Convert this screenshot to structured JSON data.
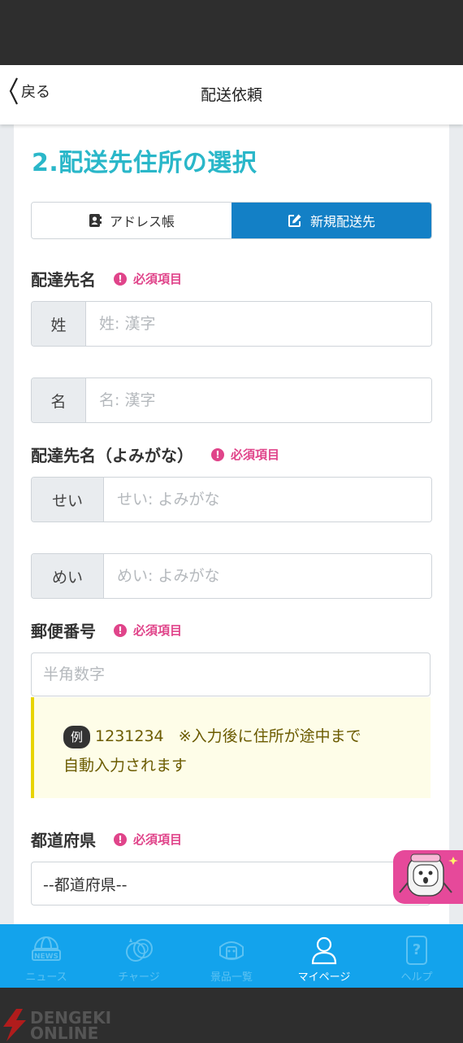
{
  "header": {
    "back_label": "戻る",
    "title": "配送依頼"
  },
  "section_title": "2.配送先住所の選択",
  "toggle": {
    "address_book": "アドレス帳",
    "new_destination": "新規配送先"
  },
  "required_label": "必須項目",
  "name": {
    "label": "配達先名",
    "last_prefix": "姓",
    "last_placeholder": "姓: 漢字",
    "first_prefix": "名",
    "first_placeholder": "名: 漢字"
  },
  "kana": {
    "label": "配達先名（よみがな）",
    "last_prefix": "せい",
    "last_placeholder": "せい: よみがな",
    "first_prefix": "めい",
    "first_placeholder": "めい: よみがな"
  },
  "postal": {
    "label": "郵便番号",
    "placeholder": "半角数字",
    "example_badge": "例",
    "example_value": "1231234",
    "note_line1": "※入力後に住所が途中まで",
    "note_line2": "自動入力されます"
  },
  "prefecture": {
    "label": "都道府県",
    "selected": "--都道府県--"
  },
  "nav": [
    {
      "label": "ニュース",
      "icon": "news-globe-icon",
      "active": false
    },
    {
      "label": "チャージ",
      "icon": "coins-icon",
      "active": false
    },
    {
      "label": "景品一覧",
      "icon": "prize-icon",
      "active": false
    },
    {
      "label": "マイページ",
      "icon": "user-icon",
      "active": true
    },
    {
      "label": "ヘルプ",
      "icon": "help-icon",
      "active": false
    }
  ],
  "watermark": {
    "line1": "DENGEKI",
    "line2": "ONLINE"
  },
  "colors": {
    "accent_teal": "#2ab7c9",
    "active_blue": "#1380c6",
    "required_pink": "#e0448a",
    "nav_blue": "#13a3ec"
  }
}
